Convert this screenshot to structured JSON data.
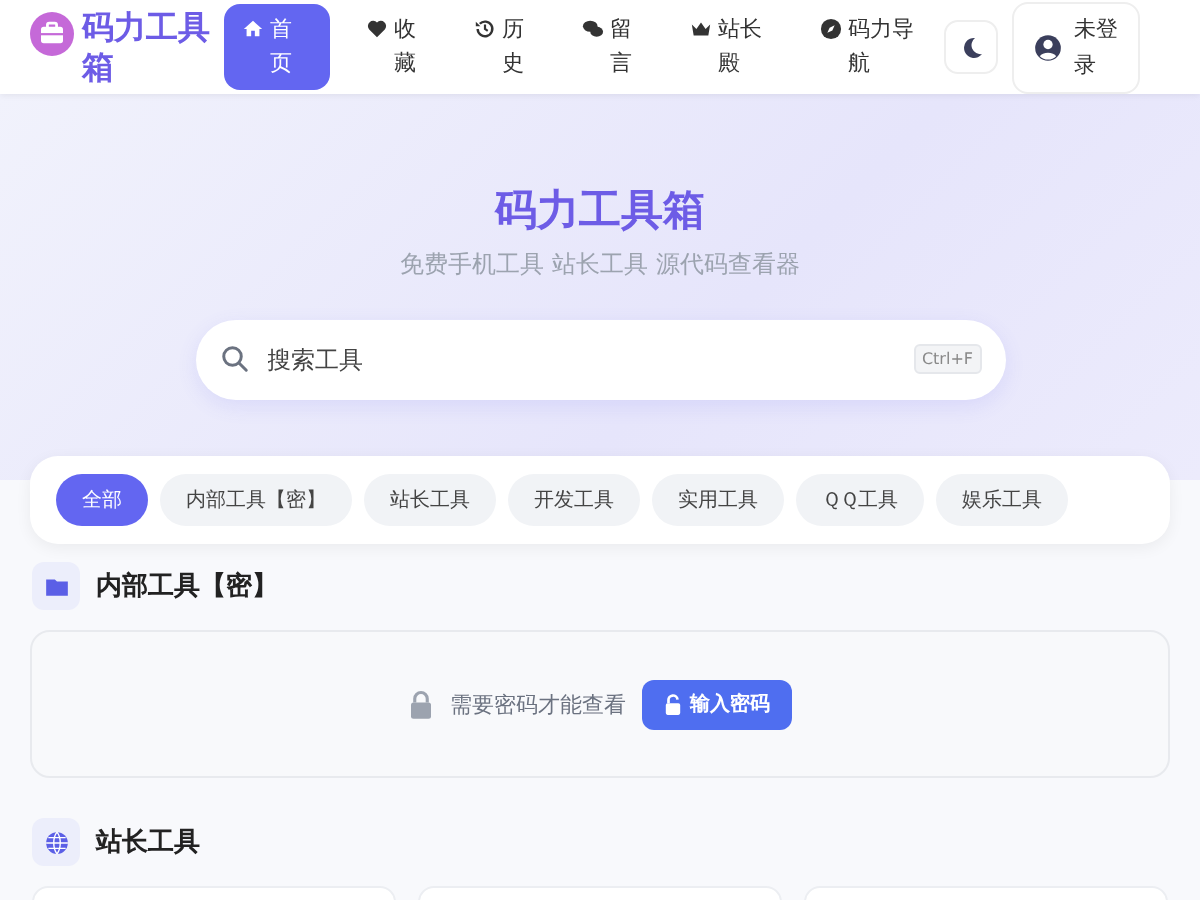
{
  "brand": {
    "name": "码力工具箱"
  },
  "nav": [
    {
      "label": "首页",
      "selected": true
    },
    {
      "label": "收藏",
      "selected": false
    },
    {
      "label": "历史",
      "selected": false
    },
    {
      "label": "留言",
      "selected": false
    },
    {
      "label": "站长殿",
      "selected": false
    },
    {
      "label": "码力导航",
      "selected": false
    }
  ],
  "login": {
    "label": "未登录"
  },
  "hero": {
    "title": "码力工具箱",
    "subtitle": "免费手机工具 站长工具 源代码查看器"
  },
  "search": {
    "placeholder": "搜索工具",
    "shortcut": "Ctrl+F"
  },
  "filters": [
    {
      "label": "全部",
      "selected": true
    },
    {
      "label": "内部工具【密】",
      "selected": false
    },
    {
      "label": "站长工具",
      "selected": false
    },
    {
      "label": "开发工具",
      "selected": false
    },
    {
      "label": "实用工具",
      "selected": false
    },
    {
      "label": "ＱＱ工具",
      "selected": false
    },
    {
      "label": "娱乐工具",
      "selected": false
    }
  ],
  "sections": [
    {
      "title": "内部工具【密】",
      "locked": true,
      "lock_text": "需要密码才能查看",
      "unlock_button": "输入密码"
    },
    {
      "title": "站长工具",
      "locked": false
    }
  ]
}
